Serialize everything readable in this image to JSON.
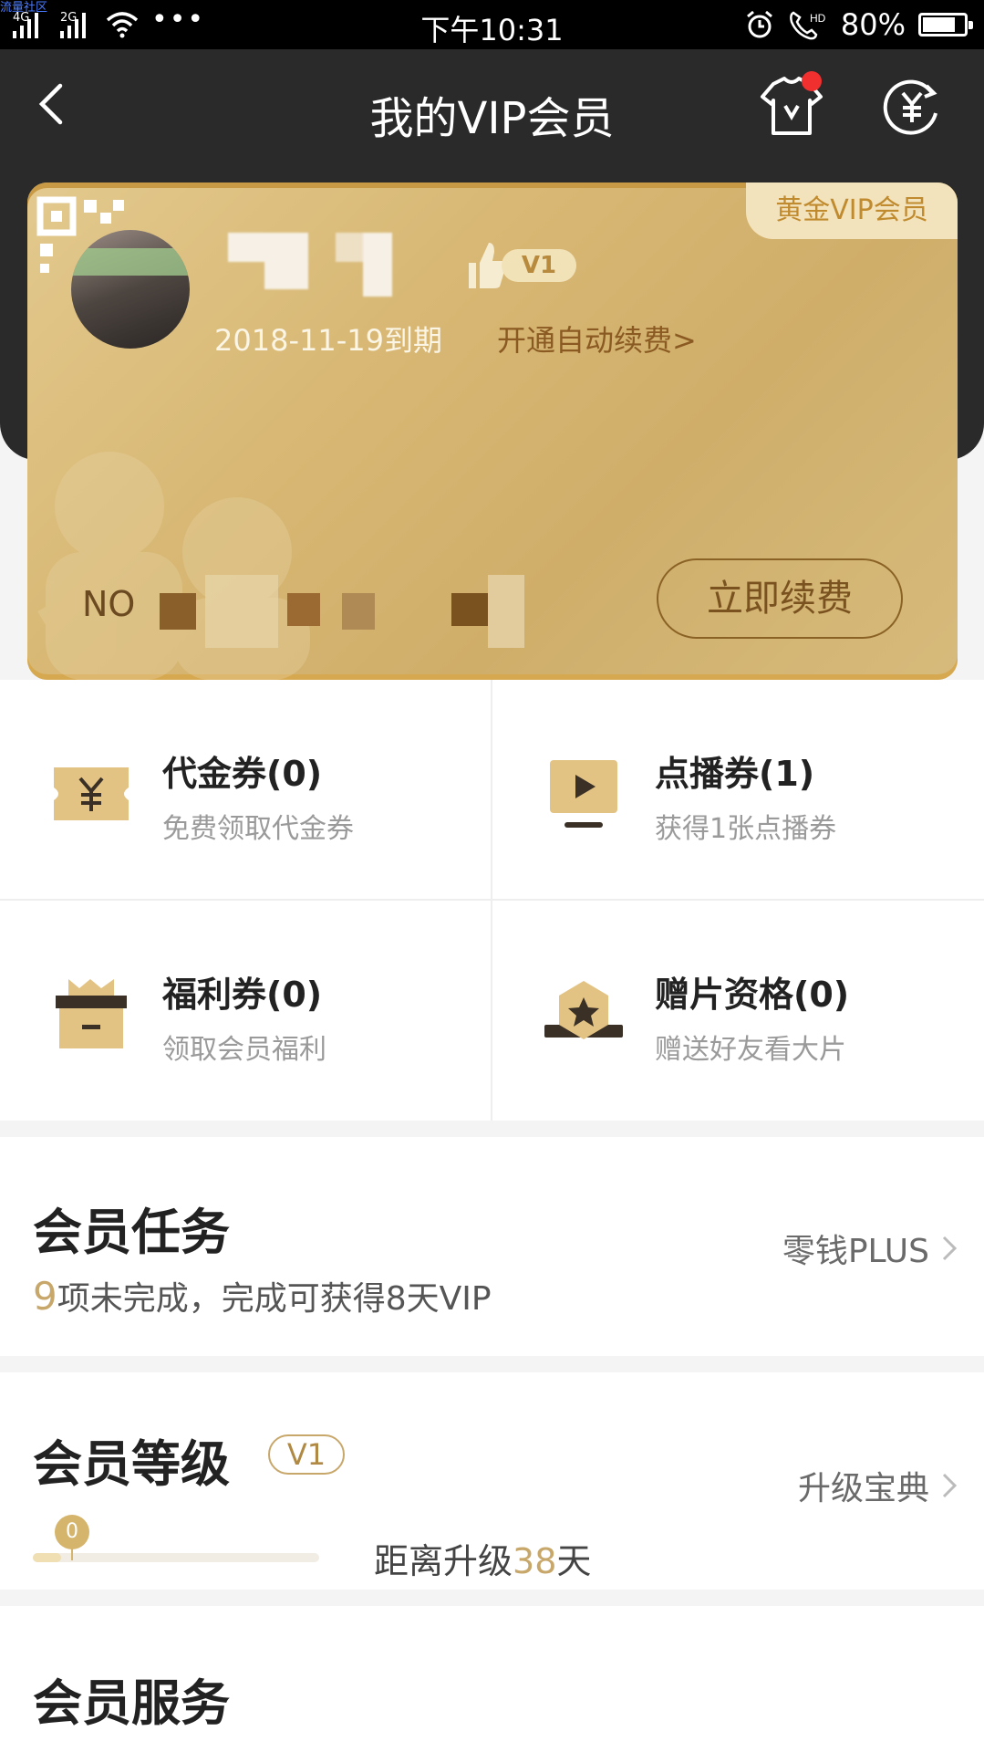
{
  "status_bar": {
    "corner_label": "流量社区",
    "network_1": "4G",
    "network_2": "2G",
    "more": "•••",
    "time": "下午10:31",
    "battery_text": "80%",
    "battery_level": 0.8
  },
  "header": {
    "title": "我的VIP会员",
    "icons": [
      "back-arrow-icon",
      "shirt-icon",
      "yuan-refresh-icon"
    ]
  },
  "vip_card": {
    "level_tag": "黄金VIP会员",
    "vip_badge": "V1",
    "expiry": "2018-11-19到期",
    "auto_renew": "开通自动续费>",
    "card_no_prefix": "NO",
    "renew_button": "立即续费"
  },
  "coupons": [
    {
      "name": "代金券(0)",
      "sub": "免费领取代金券",
      "icon": "yuan-ticket-icon"
    },
    {
      "name": "点播券(1)",
      "sub": "获得1张点播券",
      "icon": "play-screen-icon"
    },
    {
      "name": "福利券(0)",
      "sub": "领取会员福利",
      "icon": "gift-box-icon"
    },
    {
      "name": "赠片资格(0)",
      "sub": "赠送好友看大片",
      "icon": "star-hexagon-icon"
    }
  ],
  "tasks": {
    "title": "会员任务",
    "right_link": "零钱PLUS",
    "count": "9",
    "desc": "项未完成，完成可获得8天VIP"
  },
  "level": {
    "title": "会员等级",
    "badge": "V1",
    "right_link": "升级宝典",
    "progress_value": "0",
    "progress_fraction": 0.1,
    "upgrade_prefix": "距离升级",
    "upgrade_days": "38",
    "upgrade_suffix": "天"
  },
  "services": {
    "title": "会员服务"
  }
}
